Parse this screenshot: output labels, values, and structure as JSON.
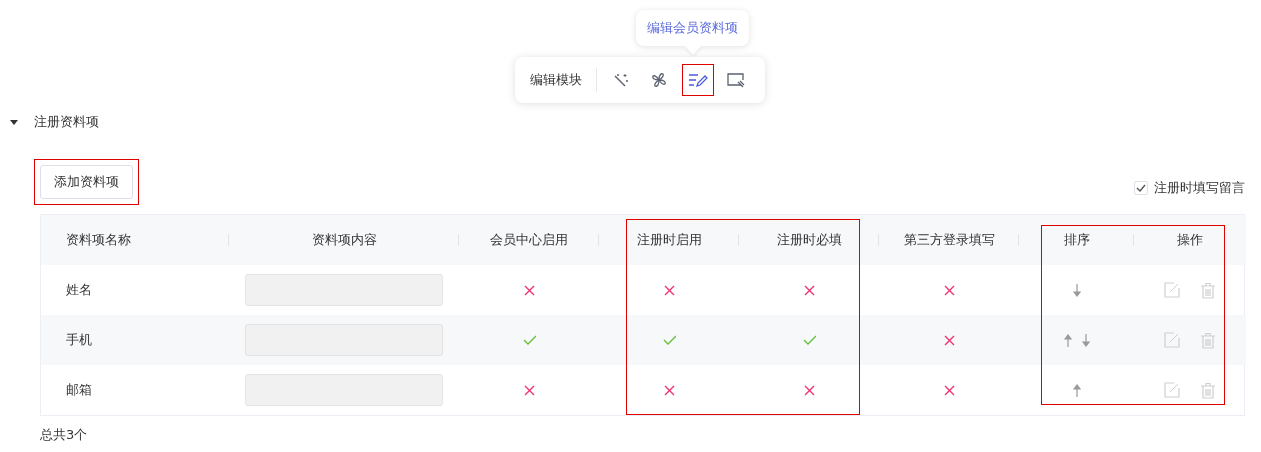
{
  "toolbar": {
    "label": "编辑模块",
    "tooltip": "编辑会员资料项",
    "tools": [
      {
        "kind": "wand",
        "selected": false,
        "highlighted": false
      },
      {
        "kind": "fan",
        "selected": false,
        "highlighted": false
      },
      {
        "kind": "list-pen",
        "selected": true,
        "highlighted": true
      },
      {
        "kind": "screen",
        "selected": false,
        "highlighted": false
      }
    ]
  },
  "section": {
    "title": "注册资料项",
    "expanded": true,
    "add_button": {
      "label": "添加资料项",
      "highlighted": true
    },
    "leave_message": {
      "label": "注册时填写留言",
      "checked": true
    }
  },
  "table": {
    "columns": [
      {
        "label": "资料项名称",
        "highlighted": false
      },
      {
        "label": "资料项内容",
        "highlighted": false
      },
      {
        "label": "会员中心启用",
        "highlighted": false
      },
      {
        "label": "注册时启用",
        "highlighted": true
      },
      {
        "label": "注册时必填",
        "highlighted": true
      },
      {
        "label": "第三方登录填写",
        "highlighted": false
      },
      {
        "label": "排序",
        "highlighted": true
      },
      {
        "label": "操作",
        "highlighted": true
      }
    ],
    "rows": [
      {
        "name": "姓名",
        "member_center": false,
        "reg_enabled": false,
        "reg_required": false,
        "third_party": false,
        "sort_up": false,
        "sort_down": true,
        "actions_disabled": true
      },
      {
        "name": "手机",
        "member_center": true,
        "reg_enabled": true,
        "reg_required": true,
        "third_party": false,
        "sort_up": true,
        "sort_down": true,
        "actions_disabled": true
      },
      {
        "name": "邮箱",
        "member_center": false,
        "reg_enabled": false,
        "reg_required": false,
        "third_party": false,
        "sort_up": true,
        "sort_down": false,
        "actions_disabled": true
      }
    ]
  },
  "footer": {
    "total": "总共3个"
  }
}
